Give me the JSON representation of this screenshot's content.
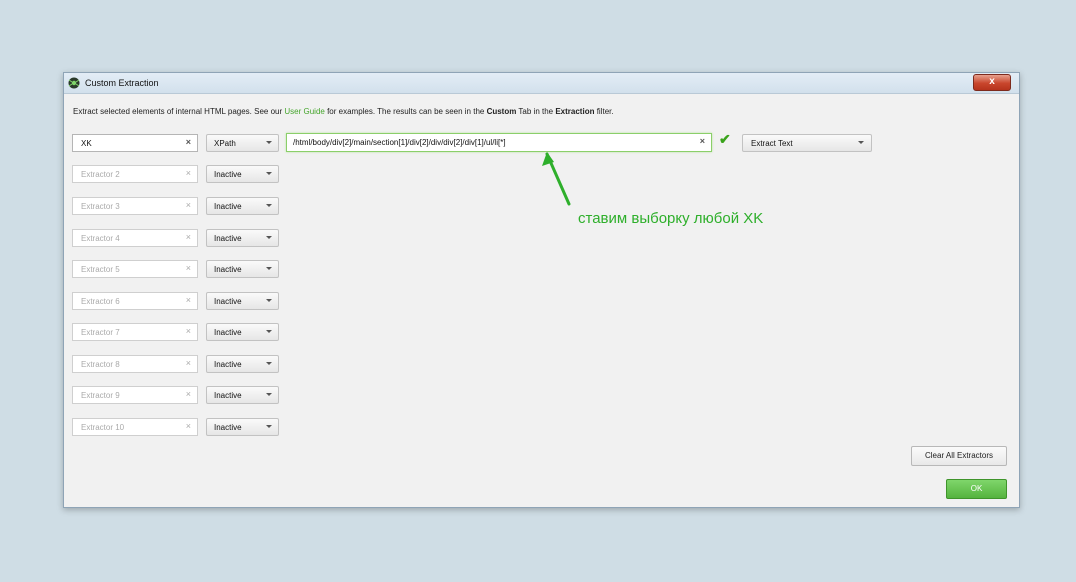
{
  "window": {
    "title": "Custom Extraction",
    "close_label": "x"
  },
  "description": {
    "part1": "Extract selected elements of internal HTML pages. See our ",
    "link": "User Guide",
    "part2": " for examples. The results can be seen in the ",
    "bold1": "Custom",
    "part3": " Tab in the ",
    "bold2": "Extraction",
    "part4": " filter."
  },
  "extractors": [
    {
      "name": "XK",
      "placeholder": "",
      "type": "XPath",
      "active": true,
      "xpath": "/html/body/div[2]/main/section[1]/div[2]/div/div[2]/div[1]/ul/li[*]",
      "extract_mode": "Extract Text"
    },
    {
      "name": "",
      "placeholder": "Extractor 2",
      "type": "Inactive",
      "active": false
    },
    {
      "name": "",
      "placeholder": "Extractor 3",
      "type": "Inactive",
      "active": false
    },
    {
      "name": "",
      "placeholder": "Extractor 4",
      "type": "Inactive",
      "active": false
    },
    {
      "name": "",
      "placeholder": "Extractor 5",
      "type": "Inactive",
      "active": false
    },
    {
      "name": "",
      "placeholder": "Extractor 6",
      "type": "Inactive",
      "active": false
    },
    {
      "name": "",
      "placeholder": "Extractor 7",
      "type": "Inactive",
      "active": false
    },
    {
      "name": "",
      "placeholder": "Extractor 8",
      "type": "Inactive",
      "active": false
    },
    {
      "name": "",
      "placeholder": "Extractor 9",
      "type": "Inactive",
      "active": false
    },
    {
      "name": "",
      "placeholder": "Extractor 10",
      "type": "Inactive",
      "active": false
    }
  ],
  "clear_icon": "×",
  "check_icon": "✔",
  "annotation": "ставим выборку любой XK",
  "buttons": {
    "clear_all": "Clear All Extractors",
    "ok": "OK"
  },
  "colors": {
    "accent_green": "#2eaf2b",
    "link_green": "#45a52c",
    "ok_green": "#55b33e"
  }
}
